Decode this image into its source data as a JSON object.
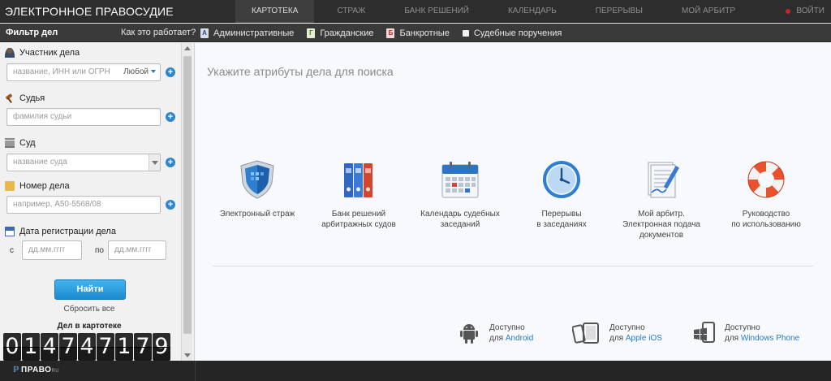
{
  "app": {
    "brand": "ЭЛЕКТРОННОЕ ПРАВОСУДИЕ",
    "login": "ВОЙТИ"
  },
  "nav": {
    "items": [
      {
        "label": "КАРТОТЕКА",
        "active": true
      },
      {
        "label": "СТРАЖ",
        "active": false
      },
      {
        "label": "БАНК РЕШЕНИЙ",
        "active": false
      },
      {
        "label": "КАЛЕНДАРЬ",
        "active": false
      },
      {
        "label": "ПЕРЕРЫВЫ",
        "active": false
      },
      {
        "label": "МОЙ АРБИТР",
        "active": false
      }
    ]
  },
  "filterbar": {
    "title": "Фильтр дел",
    "how_it_works": "Как это работает?",
    "categories": [
      {
        "label": "Административные",
        "mark": "А",
        "checked": false
      },
      {
        "label": "Гражданские",
        "mark": "Г",
        "checked": false
      },
      {
        "label": "Банкротные",
        "mark": "Б",
        "checked": false
      },
      {
        "label": "Судебные поручения",
        "mark": "",
        "checked": false
      }
    ]
  },
  "sidebar": {
    "participant": {
      "label": "Участник дела",
      "placeholder": "название, ИНН или ОГРН",
      "role": "Любой"
    },
    "judge": {
      "label": "Судья",
      "placeholder": "фамилия судьи"
    },
    "court": {
      "label": "Суд",
      "placeholder": "название суда"
    },
    "case_number": {
      "label": "Номер дела",
      "placeholder": "например, А50-5568/08"
    },
    "reg_date": {
      "label": "Дата регистрации дела",
      "from_label": "с",
      "to_label": "по",
      "from_placeholder": "дд.мм.гггг",
      "to_placeholder": "дд.мм.гггг"
    },
    "find_button": "Найти",
    "reset": "Сбросить все",
    "cases_label": "Дел в картотеке",
    "cases_count": "014747179"
  },
  "main": {
    "title": "Укажите атрибуты дела для поиска",
    "tiles": [
      {
        "line1": "Электронный страж",
        "line2": "",
        "line3": "",
        "icon": "shield-icon"
      },
      {
        "line1": "Банк решений",
        "line2": "арбитражных судов",
        "line3": "",
        "icon": "binders-icon"
      },
      {
        "line1": "Календарь судебных",
        "line2": "заседаний",
        "line3": "",
        "icon": "calendar-icon"
      },
      {
        "line1": "Перерывы",
        "line2": "в заседаниях",
        "line3": "",
        "icon": "clock-icon"
      },
      {
        "line1": "Мой арбитр.",
        "line2": "Электронная подача",
        "line3": "документов",
        "icon": "document-pen-icon"
      },
      {
        "line1": "Руководство",
        "line2": "по использованию",
        "line3": "",
        "icon": "lifebuoy-icon"
      }
    ],
    "platforms": [
      {
        "available": "Доступно",
        "for": "для",
        "name": "Android",
        "icon": "android-icon"
      },
      {
        "available": "Доступно",
        "for": "для",
        "name": "Apple iOS",
        "icon": "apple-devices-icon"
      },
      {
        "available": "Доступно",
        "for": "для",
        "name": "Windows Phone",
        "icon": "windows-phone-icon"
      }
    ]
  },
  "footer": {
    "logo_text": "ПРАВО",
    "logo_sup": "RU"
  },
  "colors": {
    "topbar": "#2d2d2d",
    "filterbar": "#3a3a3a",
    "accent_blue": "#2f86c9",
    "find_button": "#1b8bd0",
    "login_dot": "#c2262a"
  }
}
